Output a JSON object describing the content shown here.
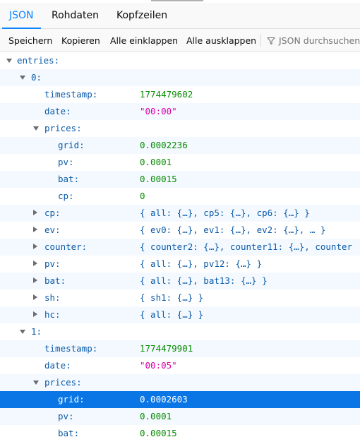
{
  "tabs": [
    "JSON",
    "Rohdaten",
    "Kopfzeilen"
  ],
  "toolbar": {
    "save": "Speichern",
    "copy": "Kopieren",
    "collapse_all": "Alle einklappen",
    "expand_all": "Alle ausklappen",
    "filter_placeholder": "JSON durchsuchen"
  },
  "colors": {
    "accent": "#0a84ff",
    "key": "#0a5aa8",
    "number": "#058b00",
    "string": "#dd00a9",
    "selected": "#0a76e6"
  },
  "tree": [
    {
      "key": "entries:",
      "value": "",
      "type": "none",
      "depth": 0,
      "twisty": "open"
    },
    {
      "key": "0:",
      "value": "",
      "type": "none",
      "depth": 1,
      "twisty": "open"
    },
    {
      "key": "timestamp:",
      "value": "1774479602",
      "type": "num",
      "depth": 2,
      "twisty": ""
    },
    {
      "key": "date:",
      "value": "\"00:00\"",
      "type": "str",
      "depth": 2,
      "twisty": ""
    },
    {
      "key": "prices:",
      "value": "",
      "type": "none",
      "depth": 2,
      "twisty": "open"
    },
    {
      "key": "grid:",
      "value": "0.0002236",
      "type": "num",
      "depth": 3,
      "twisty": ""
    },
    {
      "key": "pv:",
      "value": "0.0001",
      "type": "num",
      "depth": 3,
      "twisty": ""
    },
    {
      "key": "bat:",
      "value": "0.00015",
      "type": "num",
      "depth": 3,
      "twisty": ""
    },
    {
      "key": "cp:",
      "value": "0",
      "type": "num",
      "depth": 3,
      "twisty": ""
    },
    {
      "key": "cp:",
      "value": "{ all: {…}, cp5: {…}, cp6: {…} }",
      "type": "obj",
      "depth": 2,
      "twisty": "closed"
    },
    {
      "key": "ev:",
      "value": "{ ev0: {…}, ev1: {…}, ev2: {…}, … }",
      "type": "obj",
      "depth": 2,
      "twisty": "closed"
    },
    {
      "key": "counter:",
      "value": "{ counter2: {…}, counter11: {…}, counter",
      "type": "obj",
      "depth": 2,
      "twisty": "closed"
    },
    {
      "key": "pv:",
      "value": "{ all: {…}, pv12: {…} }",
      "type": "obj",
      "depth": 2,
      "twisty": "closed"
    },
    {
      "key": "bat:",
      "value": "{ all: {…}, bat13: {…} }",
      "type": "obj",
      "depth": 2,
      "twisty": "closed"
    },
    {
      "key": "sh:",
      "value": "{ sh1: {…} }",
      "type": "obj",
      "depth": 2,
      "twisty": "closed"
    },
    {
      "key": "hc:",
      "value": "{ all: {…} }",
      "type": "obj",
      "depth": 2,
      "twisty": "closed"
    },
    {
      "key": "1:",
      "value": "",
      "type": "none",
      "depth": 1,
      "twisty": "open"
    },
    {
      "key": "timestamp:",
      "value": "1774479901",
      "type": "num",
      "depth": 2,
      "twisty": ""
    },
    {
      "key": "date:",
      "value": "\"00:05\"",
      "type": "str",
      "depth": 2,
      "twisty": ""
    },
    {
      "key": "prices:",
      "value": "",
      "type": "none",
      "depth": 2,
      "twisty": "open"
    },
    {
      "key": "grid:",
      "value": "0.0002603",
      "type": "num",
      "depth": 3,
      "twisty": "",
      "selected": true
    },
    {
      "key": "pv:",
      "value": "0.0001",
      "type": "num",
      "depth": 3,
      "twisty": ""
    },
    {
      "key": "bat:",
      "value": "0.00015",
      "type": "num",
      "depth": 3,
      "twisty": ""
    }
  ]
}
